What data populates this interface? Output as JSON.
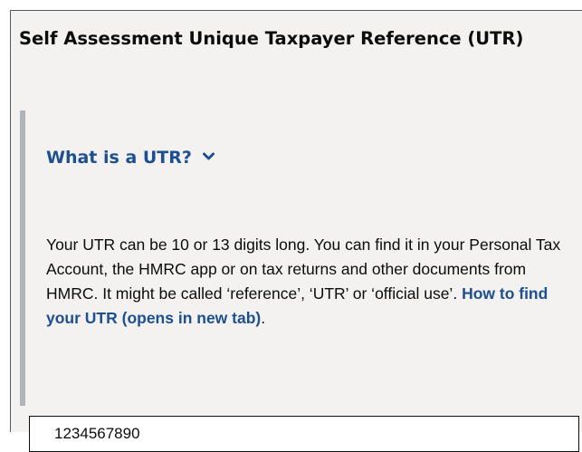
{
  "section": {
    "heading": "Self Assessment Unique Taxpayer Reference (UTR)"
  },
  "details": {
    "summary_label": "What is a UTR?",
    "summary_icon": "chevron-down-icon",
    "body_text": "Your UTR can be 10 or 13 digits long. You can find it in your Personal Tax Account, the HMRC app or on tax returns and other documents from HMRC. It might be called ‘reference’, ‘UTR’ or ‘official use’.",
    "link_text": "How to find your UTR (opens in new tab)",
    "link_suffix": ".",
    "link_color": "#1d4f91"
  },
  "utr_field": {
    "value": "1234567890"
  }
}
